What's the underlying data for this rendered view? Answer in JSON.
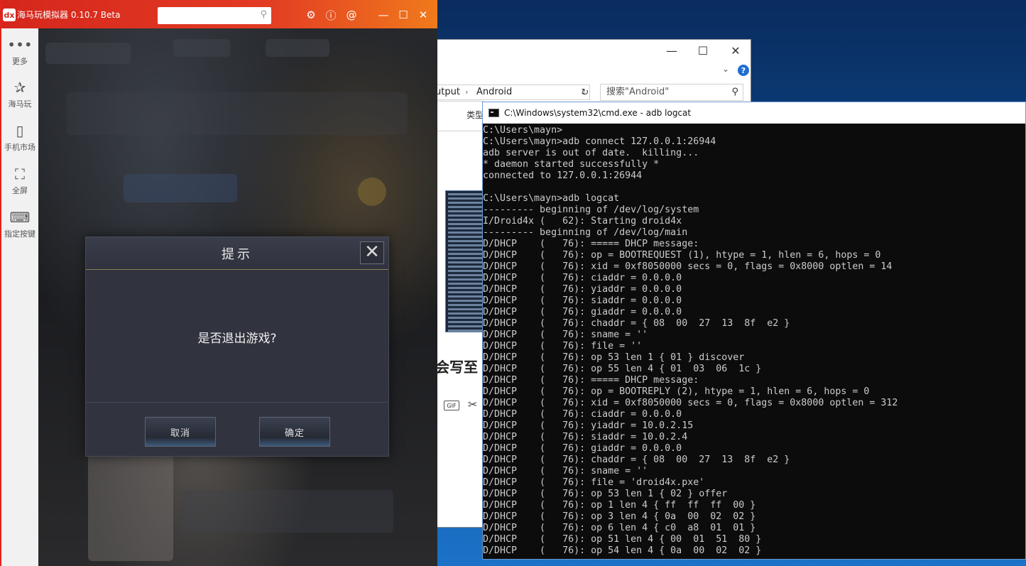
{
  "emulator": {
    "logo": "dx",
    "title": "海马玩模拟器 0.10.7 Beta",
    "sidebar": [
      {
        "icon": "more-dots-icon",
        "label": "更多"
      },
      {
        "icon": "haima-icon",
        "label": "海马玩"
      },
      {
        "icon": "phone-market-icon",
        "label": "手机市场"
      },
      {
        "icon": "fullscreen-icon",
        "label": "全屏"
      },
      {
        "icon": "keyboard-icon",
        "label": "指定按键"
      }
    ],
    "dialog": {
      "title": "提示",
      "message": "是否退出游戏?",
      "cancel": "取消",
      "confirm": "确定"
    }
  },
  "explorer": {
    "breadcrumb": [
      "utput",
      "Android"
    ],
    "search_placeholder": "搜索\"Android\"",
    "column_type": "类型",
    "partial_heading": "会写至"
  },
  "cmd": {
    "title": "C:\\Windows\\system32\\cmd.exe - adb  logcat",
    "lines": [
      "C:\\Users\\mayn>",
      "C:\\Users\\mayn>adb connect 127.0.0.1:26944",
      "adb server is out of date.  killing...",
      "* daemon started successfully *",
      "connected to 127.0.0.1:26944",
      "",
      "C:\\Users\\mayn>adb logcat",
      "--------- beginning of /dev/log/system",
      "I/Droid4x (   62): Starting droid4x",
      "--------- beginning of /dev/log/main",
      "D/DHCP    (   76): ===== DHCP message:",
      "D/DHCP    (   76): op = BOOTREQUEST (1), htype = 1, hlen = 6, hops = 0",
      "D/DHCP    (   76): xid = 0xf8050000 secs = 0, flags = 0x8000 optlen = 14",
      "D/DHCP    (   76): ciaddr = 0.0.0.0",
      "D/DHCP    (   76): yiaddr = 0.0.0.0",
      "D/DHCP    (   76): siaddr = 0.0.0.0",
      "D/DHCP    (   76): giaddr = 0.0.0.0",
      "D/DHCP    (   76): chaddr = { 08  00  27  13  8f  e2 }",
      "D/DHCP    (   76): sname = ''",
      "D/DHCP    (   76): file = ''",
      "D/DHCP    (   76): op 53 len 1 { 01 } discover",
      "D/DHCP    (   76): op 55 len 4 { 01  03  06  1c }",
      "D/DHCP    (   76): ===== DHCP message:",
      "D/DHCP    (   76): op = BOOTREPLY (2), htype = 1, hlen = 6, hops = 0",
      "D/DHCP    (   76): xid = 0xf8050000 secs = 0, flags = 0x8000 optlen = 312",
      "D/DHCP    (   76): ciaddr = 0.0.0.0",
      "D/DHCP    (   76): yiaddr = 10.0.2.15",
      "D/DHCP    (   76): siaddr = 10.0.2.4",
      "D/DHCP    (   76): giaddr = 0.0.0.0",
      "D/DHCP    (   76): chaddr = { 08  00  27  13  8f  e2 }",
      "D/DHCP    (   76): sname = ''",
      "D/DHCP    (   76): file = 'droid4x.pxe'",
      "D/DHCP    (   76): op 53 len 1 { 02 } offer",
      "D/DHCP    (   76): op 1 len 4 { ff  ff  ff  00 }",
      "D/DHCP    (   76): op 3 len 4 { 0a  00  02  02 }",
      "D/DHCP    (   76): op 6 len 4 { c0  a8  01  01 }",
      "D/DHCP    (   76): op 51 len 4 { 00  01  51  80 }",
      "D/DHCP    (   76): op 54 len 4 { 0a  00  02  02 }"
    ]
  },
  "colors": {
    "emulator_accent": "#e1251b",
    "emulator_gradient_end": "#f07a1c",
    "cmd_background": "#0c0c0c",
    "cmd_text": "#cccccc",
    "dialog_background": "#31333f"
  }
}
